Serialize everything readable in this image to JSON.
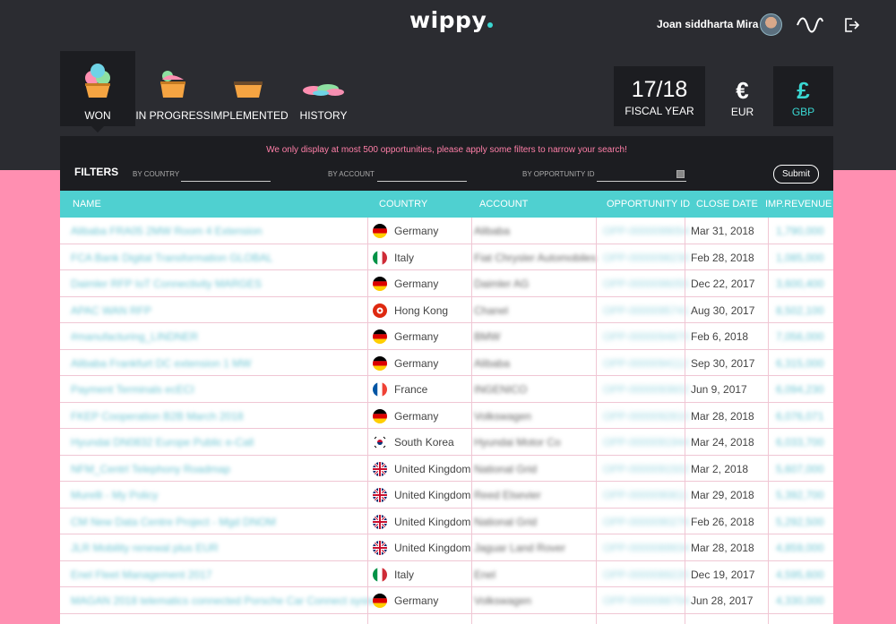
{
  "app": {
    "logo": "wippy"
  },
  "header": {
    "user_name": "Joan siddharta Mira"
  },
  "tabs": [
    {
      "label": "WON",
      "active": true,
      "icon": "cupcake-icon"
    },
    {
      "label": "IN PROGRESS",
      "active": false,
      "icon": "cake-slice-icon"
    },
    {
      "label": "IMPLEMENTED",
      "active": false,
      "icon": "pie-icon"
    },
    {
      "label": "HISTORY",
      "active": false,
      "icon": "crumbs-icon"
    }
  ],
  "fiscal": {
    "year": "17/18",
    "label": "FISCAL YEAR"
  },
  "currencies": [
    {
      "symbol": "€",
      "code": "EUR",
      "selected": false
    },
    {
      "symbol": "£",
      "code": "GBP",
      "selected": true
    }
  ],
  "notice": "We only display at most 500 opportunities, please apply some filters to narrow your search!",
  "filters": {
    "title": "FILTERS",
    "by_country": "BY COUNTRY",
    "by_account": "BY ACCOUNT",
    "by_opportunity": "BY OPPORTUNITY ID",
    "submit": "Submit"
  },
  "table": {
    "columns": [
      "NAME",
      "COUNTRY",
      "ACCOUNT",
      "OPPORTUNITY ID",
      "CLOSE DATE",
      "IMP.REVENUE"
    ],
    "rows": [
      {
        "name": "Alibaba FRA05 2MW Room 4 Extension",
        "flag": "de",
        "country": "Germany",
        "account": "Alibaba",
        "opp": "OPP-0000099054",
        "date": "Mar 31, 2018",
        "revenue": "1,790,000"
      },
      {
        "name": "FCA Bank Digital Transformation GLOBAL",
        "flag": "it",
        "country": "Italy",
        "account": "Fiat Chrysler Automobiles",
        "opp": "OPP-0000098230",
        "date": "Feb 28, 2018",
        "revenue": "1,085,000"
      },
      {
        "name": "Daimler RFP IoT Connectivity MARGES",
        "flag": "de",
        "country": "Germany",
        "account": "Daimler AG",
        "opp": "OPP-0000096055",
        "date": "Dec 22, 2017",
        "revenue": "3,600,400"
      },
      {
        "name": "APAC WAN RFP",
        "flag": "hk",
        "country": "Hong Kong",
        "account": "Chanel",
        "opp": "OPP-0000095741",
        "date": "Aug 30, 2017",
        "revenue": "8,502,100"
      },
      {
        "name": "#manufacturing_LINDNER",
        "flag": "de",
        "country": "Germany",
        "account": "BMW",
        "opp": "OPP-0000094870",
        "date": "Feb 6, 2018",
        "revenue": "7,056,000"
      },
      {
        "name": "Alibaba Frankfurt DC extension 1 MW",
        "flag": "de",
        "country": "Germany",
        "account": "Alibaba",
        "opp": "OPP-0000094112",
        "date": "Sep 30, 2017",
        "revenue": "6,315,000"
      },
      {
        "name": "Payment Terminals ecECI",
        "flag": "fr",
        "country": "France",
        "account": "INGENICO",
        "opp": "OPP-0000093602",
        "date": "Jun 9, 2017",
        "revenue": "6,094,230"
      },
      {
        "name": "FKEP Cooperation B2B March 2018",
        "flag": "de",
        "country": "Germany",
        "account": "Volkswagen",
        "opp": "OPP-0000092810",
        "date": "Mar 28, 2018",
        "revenue": "6,076,071"
      },
      {
        "name": "Hyundai DN0832 Europe Public e-Call",
        "flag": "kr",
        "country": "South Korea",
        "account": "Hyundai Motor Co",
        "opp": "OPP-0000091944",
        "date": "Mar 24, 2018",
        "revenue": "6,033,700"
      },
      {
        "name": "NFM_Centrl Telephony Roadmap",
        "flag": "gb",
        "country": "United Kingdom",
        "account": "National Grid",
        "opp": "OPP-0000091502",
        "date": "Mar 2, 2018",
        "revenue": "5,607,000"
      },
      {
        "name": "Murelli - My Policy",
        "flag": "gb",
        "country": "United Kingdom",
        "account": "Reed Elsevier",
        "opp": "OPP-0000090811",
        "date": "Mar 29, 2018",
        "revenue": "5,392,700"
      },
      {
        "name": "CM New Data Centre Project - Mgd DNOM",
        "flag": "gb",
        "country": "United Kingdom",
        "account": "National Grid",
        "opp": "OPP-0000090276",
        "date": "Feb 26, 2018",
        "revenue": "5,292,500"
      },
      {
        "name": "JLR Mobility renewal plus EUR",
        "flag": "gb",
        "country": "United Kingdom",
        "account": "Jaguar Land Rover",
        "opp": "OPP-0000089934",
        "date": "Mar 28, 2018",
        "revenue": "4,859,000"
      },
      {
        "name": "Enel Fleet Management 2017",
        "flag": "it",
        "country": "Italy",
        "account": "Enel",
        "opp": "OPP-0000089220",
        "date": "Dec 19, 2017",
        "revenue": "4,595,600"
      },
      {
        "name": "MAGAN 2018 telematics connected Porsche Car Connect system",
        "flag": "de",
        "country": "Germany",
        "account": "Volkswagen",
        "opp": "OPP-0000088704",
        "date": "Jun 28, 2017",
        "revenue": "4,330,000"
      }
    ]
  }
}
